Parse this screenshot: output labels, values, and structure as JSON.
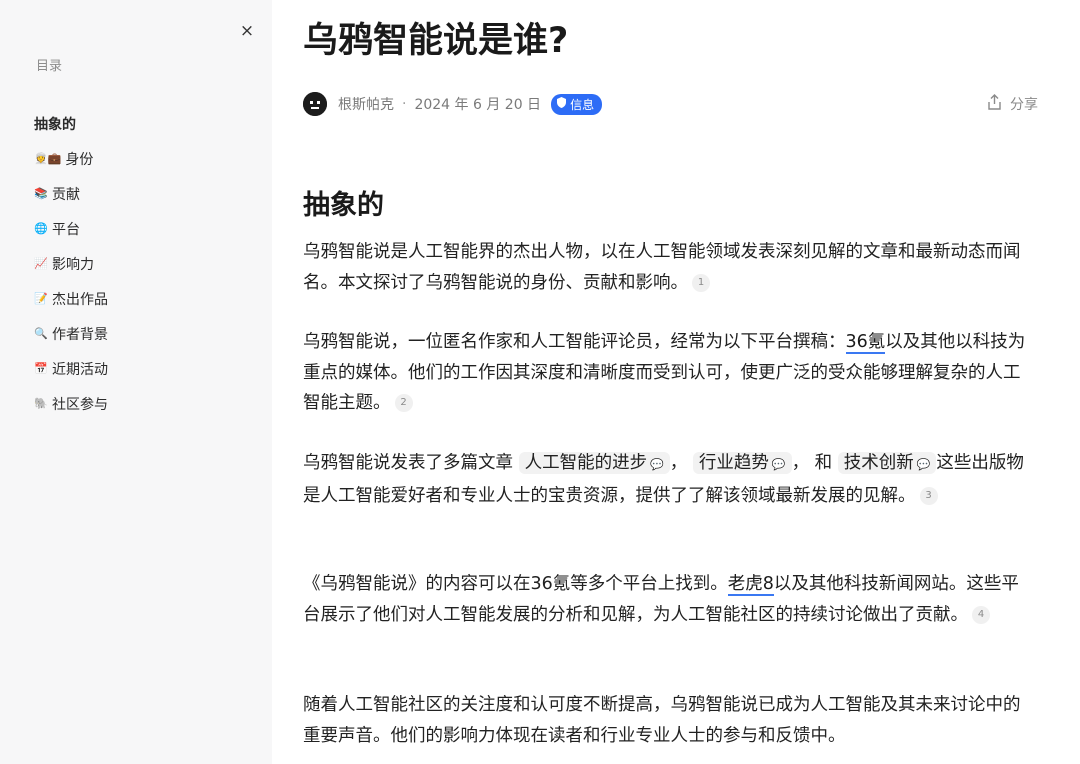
{
  "sidebar": {
    "close_label": "×",
    "toc_title": "目录",
    "items": [
      {
        "emoji": "",
        "label": "抽象的",
        "heading": true
      },
      {
        "emoji": "👳💼",
        "label": "身份"
      },
      {
        "emoji": "📚",
        "label": "贡献"
      },
      {
        "emoji": "🌐",
        "label": "平台"
      },
      {
        "emoji": "📈",
        "label": "影响力"
      },
      {
        "emoji": "📝",
        "label": "杰出作品"
      },
      {
        "emoji": "🔍",
        "label": "作者背景"
      },
      {
        "emoji": "📅",
        "label": "近期活动"
      },
      {
        "emoji": "🐘",
        "label": "社区参与"
      }
    ]
  },
  "article": {
    "title": "乌鸦智能说是谁?",
    "author": "根斯帕克",
    "date": "2024 年 6 月 20 日",
    "badge": "信息",
    "share_label": "分享",
    "section_heading": "抽象的",
    "p1": {
      "text": "乌鸦智能说是人工智能界的杰出人物，以在人工智能领域发表深刻见解的文章和最新动态而闻名。本文探讨了乌鸦智能说的身份、贡献和影响。",
      "ref": "1"
    },
    "p2": {
      "before": "乌鸦智能说，一位匿名作家和人工智能评论员，经常为以下平台撰稿：",
      "link": "36氪",
      "after": "以及其他以科技为重点的媒体。他们的工作因其深度和清晰度而受到认可，使更广泛的受众能够理解复杂的人工智能主题。",
      "ref": "2"
    },
    "p3": {
      "before": "乌鸦智能说发表了多篇文章",
      "chip1": "人工智能的进步",
      "sep1": "，",
      "chip2": "行业趋势",
      "sep2": "，  和",
      "chip3": "技术创新",
      "after": "这些出版物是人工智能爱好者和专业人士的宝贵资源，提供了了解该领域最新发展的见解。",
      "ref": "3"
    },
    "p4": {
      "before": "《乌鸦智能说》的内容可以在36氪等多个平台上找到。",
      "link": "老虎8",
      "after": "以及其他科技新闻网站。这些平台展示了他们对人工智能发展的分析和见解，为人工智能社区的持续讨论做出了贡献。",
      "ref": "4"
    },
    "p5": {
      "text": "随着人工智能社区的关注度和认可度不断提高，乌鸦智能说已成为人工智能及其未来讨论中的重要声音。他们的影响力体现在读者和行业专业人士的参与和反馈中。"
    }
  },
  "icons": {
    "close": "close-icon",
    "avatar": "avatar-icon",
    "shield": "shield-icon",
    "share": "share-icon",
    "chat": "chat-icon"
  },
  "colors": {
    "sidebar_bg": "#f7f7f8",
    "badge": "#2d6cf6",
    "link_underline": "#3a78f2"
  }
}
